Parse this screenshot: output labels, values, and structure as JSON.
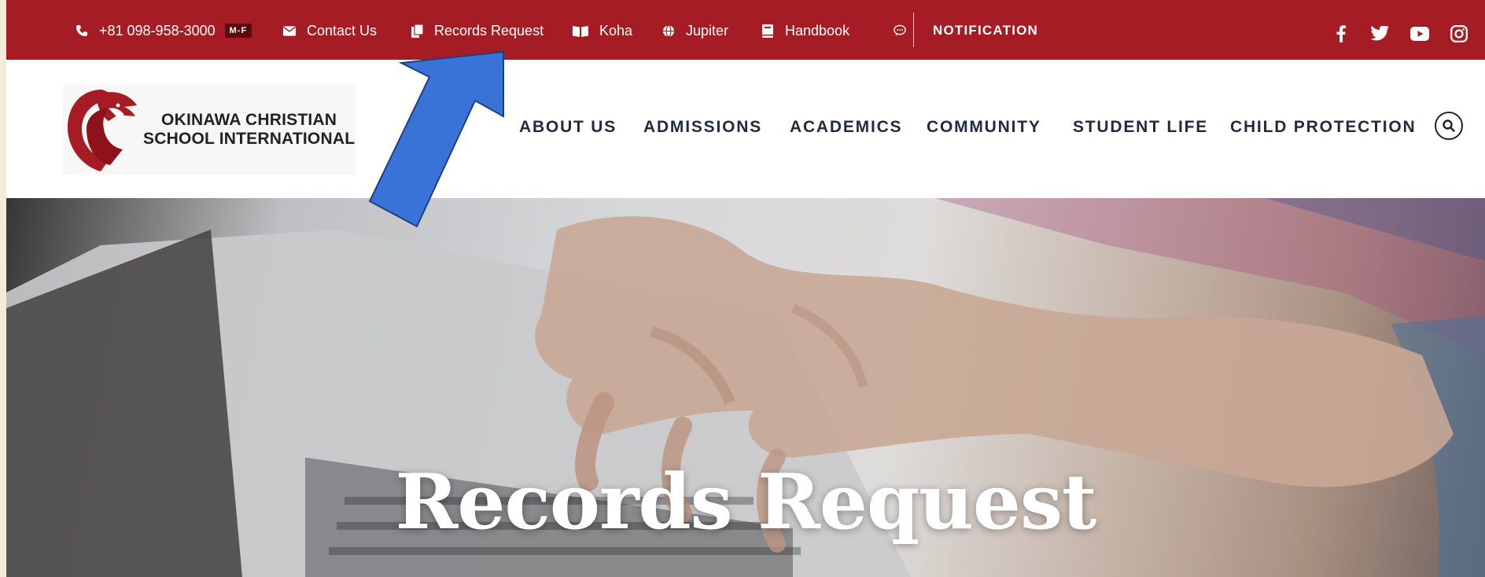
{
  "topbar": {
    "phone": "+81 098-958-3000",
    "hours_badge": "M-F",
    "contact": "Contact Us",
    "records": "Records Request",
    "koha": "Koha",
    "jupiter": "Jupiter",
    "handbook": "Handbook",
    "notification": "NOTIFICATION",
    "icons": [
      "phone-icon",
      "envelope-icon",
      "document-icon",
      "book-icon",
      "globe-icon",
      "handbook-icon",
      "chat-icon"
    ],
    "social": [
      "facebook-icon",
      "twitter-icon",
      "youtube-icon",
      "instagram-icon"
    ]
  },
  "logo": {
    "line1": "OKINAWA CHRISTIAN",
    "line2": "SCHOOL INTERNATIONAL"
  },
  "nav": {
    "items": [
      "ABOUT US",
      "ADMISSIONS",
      "ACADEMICS",
      "COMMUNITY",
      "STUDENT LIFE",
      "CHILD PROTECTION"
    ],
    "search_icon": "search-icon"
  },
  "hero": {
    "title": "Records Request"
  },
  "colors": {
    "brand_red": "#a51c24",
    "nav_text": "#1f2a44",
    "annotation_arrow": "#3a73d8"
  }
}
